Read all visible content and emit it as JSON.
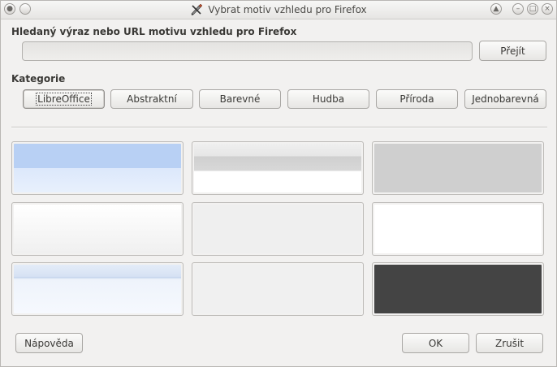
{
  "window": {
    "title": "Vybrat motiv vzhledu pro Firefox"
  },
  "search": {
    "label": "Hledaný výraz nebo URL motivu vzhledu pro Firefox",
    "value": "",
    "go_label": "Přejít"
  },
  "categories": {
    "label": "Kategorie",
    "items": [
      {
        "label": "LibreOffice",
        "selected": true
      },
      {
        "label": "Abstraktní"
      },
      {
        "label": "Barevné"
      },
      {
        "label": "Hudba"
      },
      {
        "label": "Příroda"
      },
      {
        "label": "Jednobarevná"
      }
    ]
  },
  "themes": [
    {
      "name": "light-blue"
    },
    {
      "name": "gray-white"
    },
    {
      "name": "light-gray"
    },
    {
      "name": "white-gradient"
    },
    {
      "name": "pale-gray"
    },
    {
      "name": "white"
    },
    {
      "name": "pale-blue"
    },
    {
      "name": "off-white"
    },
    {
      "name": "dark-gray"
    }
  ],
  "footer": {
    "help_label": "Nápověda",
    "ok_label": "OK",
    "cancel_label": "Zrušit"
  },
  "icons": {
    "app": "paintbrush-tools-icon",
    "menu": "window-menu-icon",
    "titlebar": [
      "window-menu-icon",
      "shade-up-icon",
      "minimize-icon",
      "maximize-icon",
      "close-icon"
    ]
  }
}
